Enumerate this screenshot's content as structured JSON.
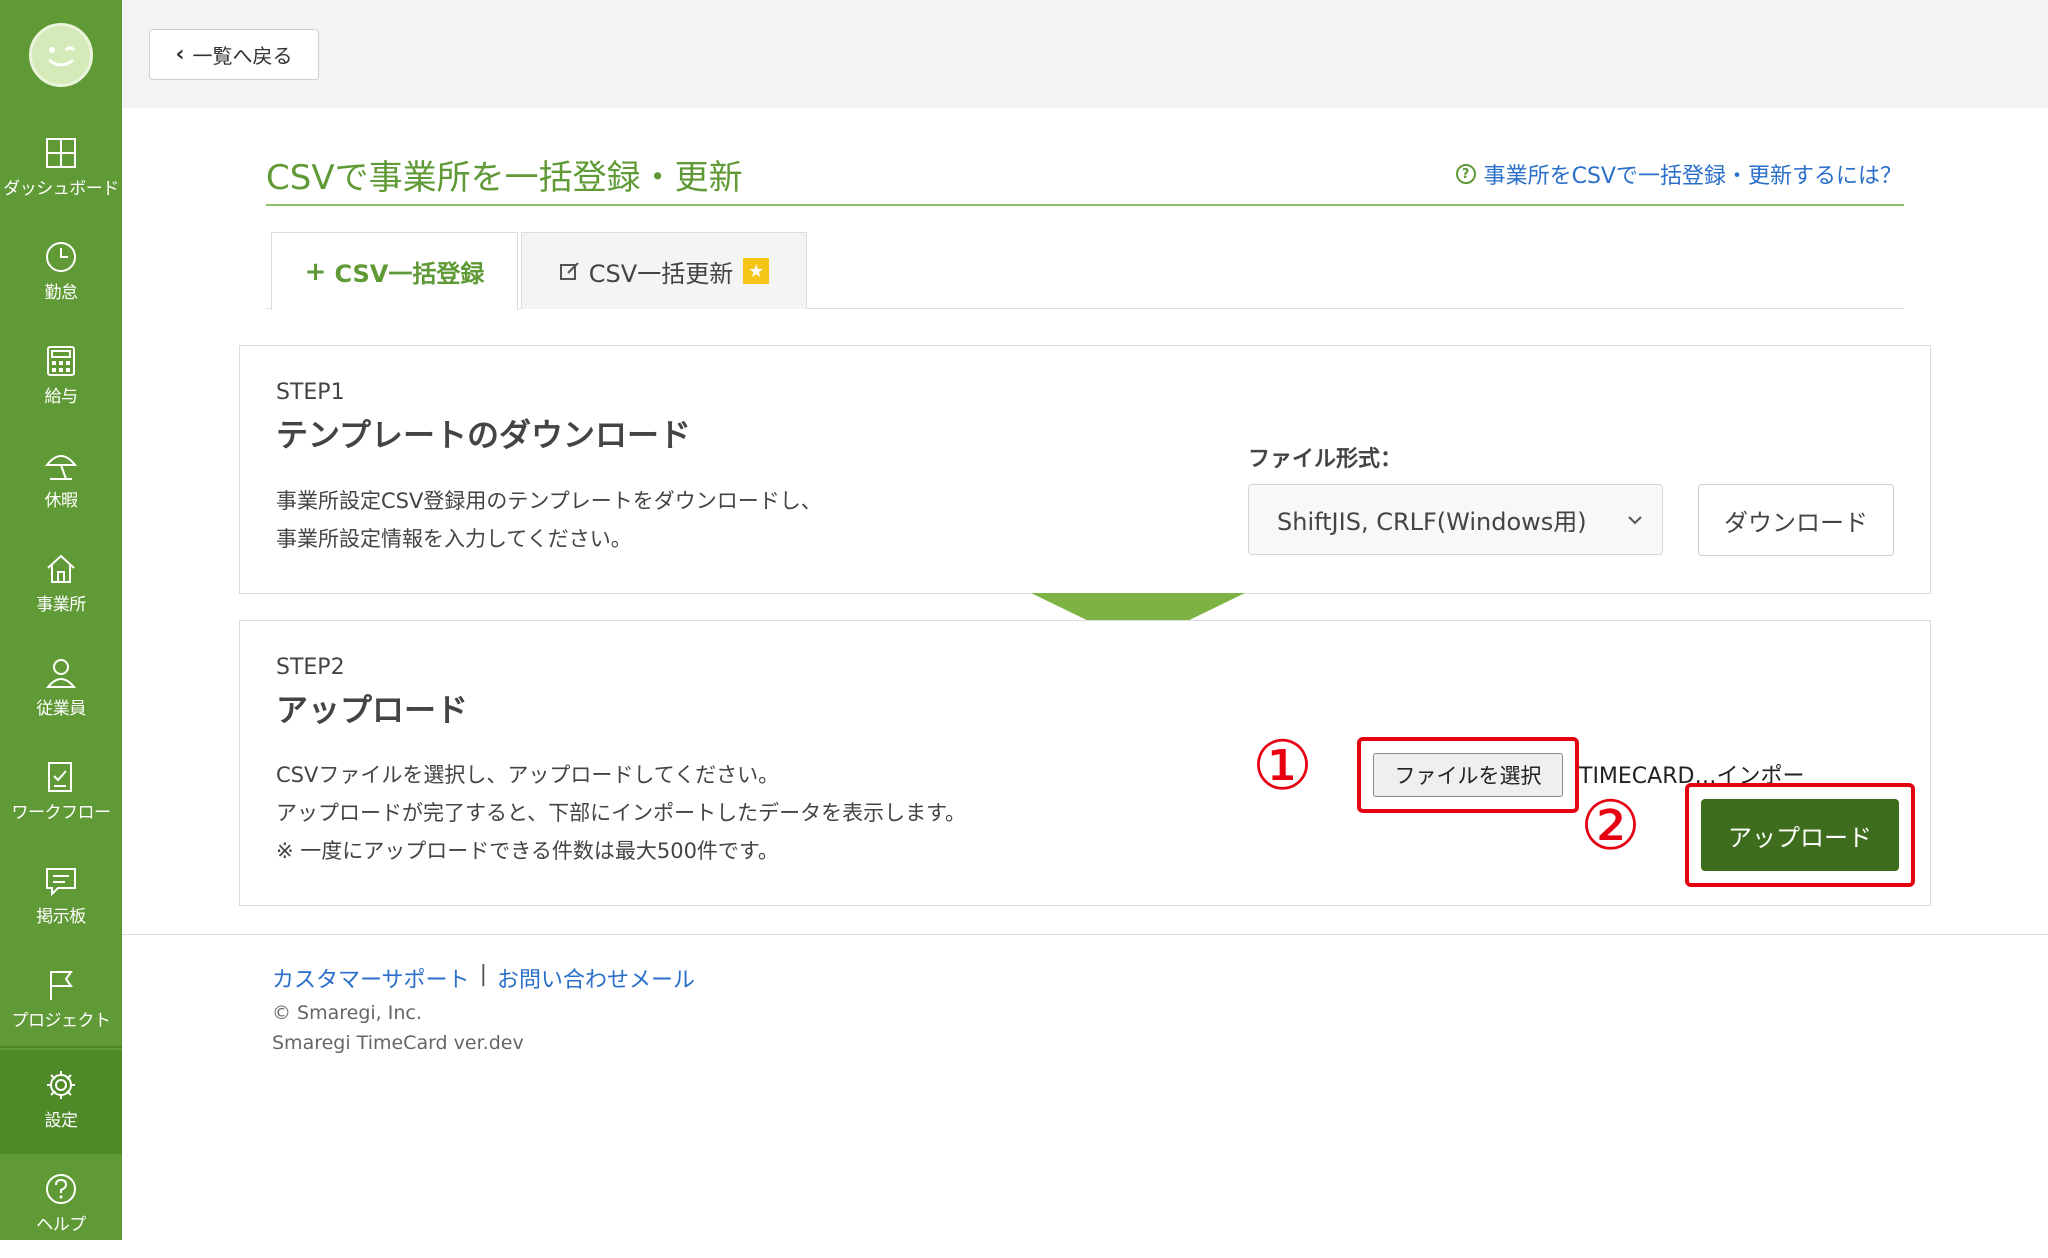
{
  "sidebar": {
    "items": [
      {
        "label": "ダッシュボード",
        "icon": "dashboard-icon"
      },
      {
        "label": "勤怠",
        "icon": "clock-icon"
      },
      {
        "label": "給与",
        "icon": "calculator-icon"
      },
      {
        "label": "休暇",
        "icon": "umbrella-icon"
      },
      {
        "label": "事業所",
        "icon": "home-icon"
      },
      {
        "label": "従業員",
        "icon": "user-icon"
      },
      {
        "label": "ワークフロー",
        "icon": "checklist-icon"
      },
      {
        "label": "掲示板",
        "icon": "chat-icon"
      },
      {
        "label": "プロジェクト",
        "icon": "flag-icon"
      },
      {
        "label": "設定",
        "icon": "gear-icon"
      },
      {
        "label": "ヘルプ",
        "icon": "help-icon"
      }
    ]
  },
  "topbar": {
    "back_label": "一覧へ戻る"
  },
  "page": {
    "title": "CSVで事業所を一括登録・更新",
    "help_link": "事業所をCSVで一括登録・更新するには？"
  },
  "tabs": [
    {
      "label": "CSV一括登録",
      "icon": "plus-icon"
    },
    {
      "label": "CSV一括更新",
      "icon": "edit-icon"
    }
  ],
  "step1": {
    "label": "STEP1",
    "title": "テンプレートのダウンロード",
    "desc_line1": "事業所設定CSV登録用のテンプレートをダウンロードし、",
    "desc_line2": "事業所設定情報を入力してください。",
    "format_label": "ファイル形式：",
    "format_value": "ShiftJIS, CRLF(Windows用)",
    "download_label": "ダウンロード"
  },
  "step2": {
    "label": "STEP2",
    "title": "アップロード",
    "desc_line1": "CSVファイルを選択し、アップロードしてください。",
    "desc_line2": "アップロードが完了すると、下部にインポートしたデータを表示します。",
    "desc_line3": "※ 一度にアップロードできる件数は最大500件です。",
    "file_button": "ファイルを選択",
    "file_name": "TIMECARD…インポート.csv",
    "upload_label": "アップロード",
    "marker1": "①",
    "marker2": "②"
  },
  "footer": {
    "support_link": "カスタマーサポート",
    "separator": "|",
    "contact_link": "お問い合わせメール",
    "copyright": "© Smaregi, Inc.",
    "version": "Smaregi TimeCard ver.dev"
  },
  "colors": {
    "brand_green": "#5f9a36",
    "dark_green": "#3e6e1d",
    "marker_red": "#e60012",
    "link_blue": "#2a6fc9"
  }
}
